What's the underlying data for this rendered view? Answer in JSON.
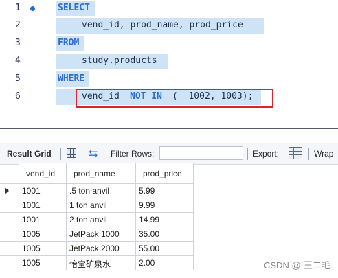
{
  "editor": {
    "lines": [
      {
        "num": "1",
        "kw": "SELECT",
        "text": "",
        "selected": true,
        "dot": true
      },
      {
        "num": "2",
        "kw": "",
        "text": "vend_id, prod_name, prod_price",
        "selected": true,
        "dot": false
      },
      {
        "num": "3",
        "kw": "FROM",
        "text": "",
        "selected": true,
        "dot": false
      },
      {
        "num": "4",
        "kw": "",
        "text": "study.products",
        "selected": true,
        "dot": false
      },
      {
        "num": "5",
        "kw": "WHERE",
        "text": "",
        "selected": true,
        "dot": false
      },
      {
        "num": "6",
        "pre": "vend_id",
        "kw": "NOT IN",
        "text": "(  1002, 1003);",
        "selected": true,
        "dot": false
      }
    ]
  },
  "toolbar": {
    "result_grid_label": "Result Grid",
    "filter_rows_label": "Filter Rows:",
    "filter_value": "",
    "export_label": "Export:",
    "wrap_label": "Wrap"
  },
  "grid": {
    "columns": [
      "vend_id",
      "prod_name",
      "prod_price"
    ],
    "rows": [
      {
        "vend_id": "1001",
        "prod_name": ".5 ton anvil",
        "prod_price": "5.99",
        "current": true
      },
      {
        "vend_id": "1001",
        "prod_name": "1 ton anvil",
        "prod_price": "9.99",
        "current": false
      },
      {
        "vend_id": "1001",
        "prod_name": "2 ton anvil",
        "prod_price": "14.99",
        "current": false
      },
      {
        "vend_id": "1005",
        "prod_name": "JetPack 1000",
        "prod_price": "35.00",
        "current": false
      },
      {
        "vend_id": "1005",
        "prod_name": "JetPack 2000",
        "prod_price": "55.00",
        "current": false
      },
      {
        "vend_id": "1005",
        "prod_name": "怡宝矿泉水",
        "prod_price": "2.00",
        "current": false
      }
    ]
  },
  "watermark": "CSDN @-王二毛-",
  "colors": {
    "keyword": "#2f6fd0",
    "selection": "#cfe3f7",
    "highlight_box": "#d7262e",
    "line_dot": "#1f6ed4"
  }
}
